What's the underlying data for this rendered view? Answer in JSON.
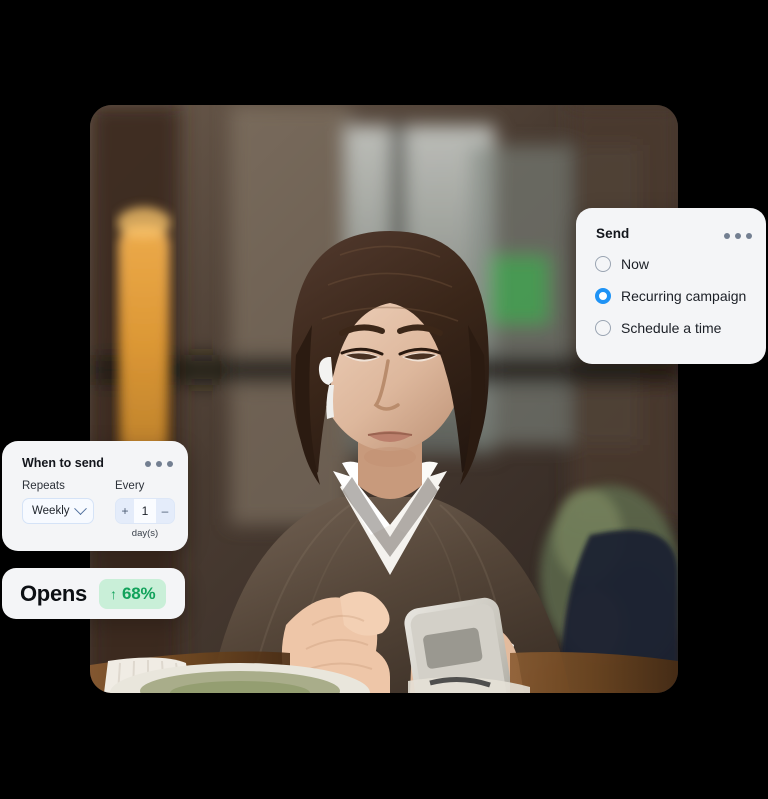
{
  "photo": {
    "alt": "Woman with brown bob haircut wearing a brown sweater over white collared shirt, using a smartphone at a cafe table"
  },
  "send_card": {
    "title": "Send",
    "menu_icon": "more-horizontal-icon",
    "options": [
      {
        "label": "Now",
        "selected": false
      },
      {
        "label": "Recurring campaign",
        "selected": true
      },
      {
        "label": "Schedule a time",
        "selected": false
      }
    ],
    "accent_color": "#1f93f5"
  },
  "when_card": {
    "title": "When to send",
    "menu_icon": "more-horizontal-icon",
    "repeats": {
      "label": "Repeats",
      "value": "Weekly",
      "chevron_icon": "chevron-down-icon"
    },
    "every": {
      "label": "Every",
      "increment_label": "+",
      "value": "1",
      "decrement_label": "–",
      "unit": "day(s)"
    }
  },
  "opens_card": {
    "label": "Opens",
    "trend_icon": "arrow-up-icon",
    "trend_arrow": "↑",
    "value": "68%",
    "badge_color": "#c9efd8",
    "value_color": "#12a25b"
  }
}
